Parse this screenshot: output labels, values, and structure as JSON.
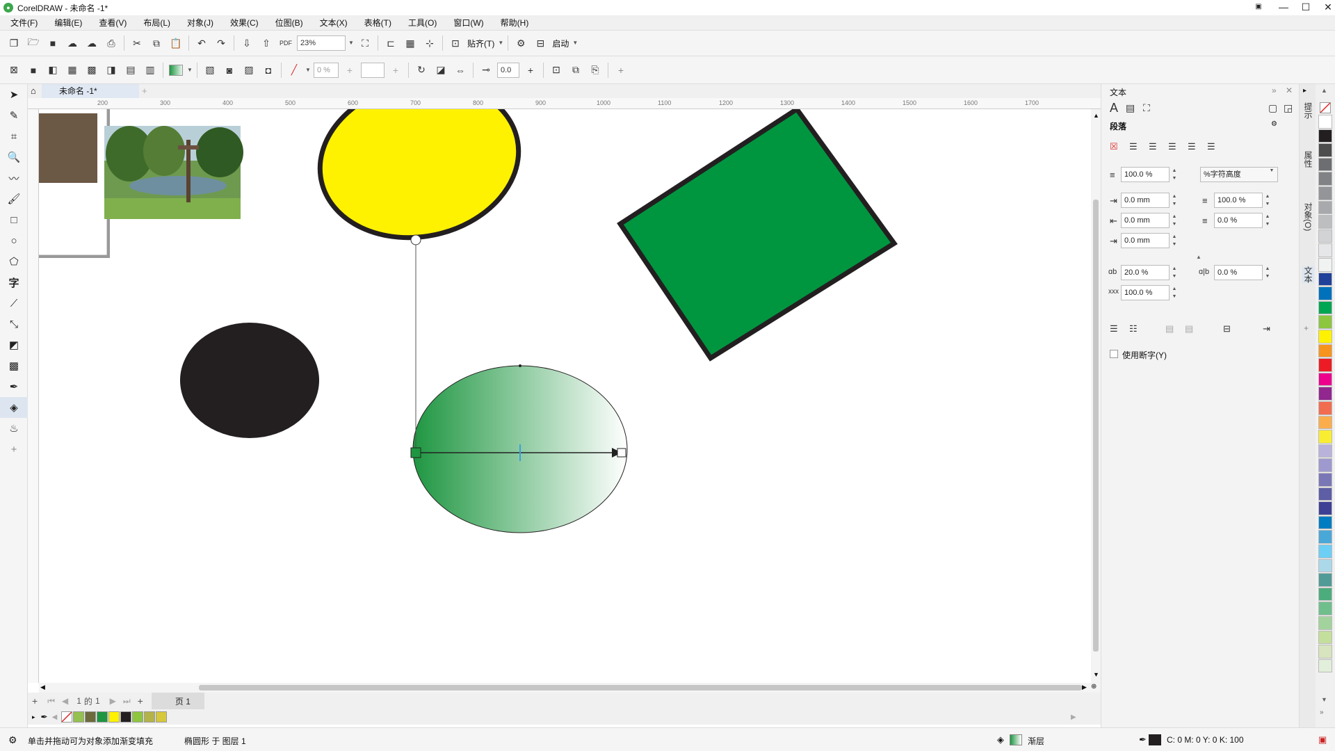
{
  "window": {
    "title": "CorelDRAW - 未命名 -1*",
    "minimize": "—",
    "maximize": "☐",
    "close": "✕"
  },
  "menu": [
    "文件(F)",
    "编辑(E)",
    "查看(V)",
    "布局(L)",
    "对象(J)",
    "效果(C)",
    "位图(B)",
    "文本(X)",
    "表格(T)",
    "工具(O)",
    "窗口(W)",
    "帮助(H)"
  ],
  "toolbar": {
    "zoom": "23%",
    "snap_label": "贴齐(T)",
    "launch_label": "启动"
  },
  "propbar": {
    "opacity": "0 %",
    "outline_width": "0.0"
  },
  "doc": {
    "tab_label": "未命名 -1*"
  },
  "ruler": {
    "h_ticks": [
      "200",
      "300",
      "400",
      "500",
      "600",
      "700",
      "800",
      "900",
      "1000",
      "1100",
      "1200",
      "1300",
      "1400",
      "1500",
      "1600",
      "1700"
    ]
  },
  "page": {
    "current": "1",
    "of_label": "的",
    "total": "1",
    "page_tab": "页 1"
  },
  "palette": [
    "#ffffff",
    "#94c14f",
    "#6d6a3c",
    "#1e9641",
    "#fff200",
    "#231f20",
    "#8ec63f",
    "#b3b34a",
    "#d6c83a"
  ],
  "status": {
    "hint": "单击并拖动可为对象添加渐变填充",
    "object_info": "椭圆形 于 图层 1",
    "fill_label": "渐层",
    "outline_info": "C: 0 M: 0 Y: 0 K: 100"
  },
  "panel": {
    "title": "文本",
    "section": "段落",
    "first_line_spacing": "100.0 %",
    "spacing_unit": "%字符高度",
    "left_indent": "0.0 mm",
    "first_indent": "0.0 mm",
    "right_indent": "0.0 mm",
    "before_para": "100.0 %",
    "after_para": "0.0 %",
    "char_spacing": "20.0 %",
    "word_spacing": "0.0 %",
    "lang_spacing": "100.0 %",
    "hyphen_label": "使用断字(Y)"
  },
  "sidetabs": [
    "提示",
    "属性",
    "对象(O)",
    "文本"
  ],
  "colorstrip": [
    "#ffffff",
    "#231f20",
    "#4d4d4d",
    "#6d6e71",
    "#808285",
    "#939598",
    "#a7a9ac",
    "#bcbec0",
    "#d1d3d4",
    "#e6e7e8",
    "#f1f2f2",
    "#21409a",
    "#0072bc",
    "#00a651",
    "#8dc63f",
    "#fff200",
    "#f7941d",
    "#ed1c24",
    "#ec008c",
    "#92278f",
    "#f26c4f",
    "#fbad4c",
    "#f9ed32",
    "#b9b3dc",
    "#9e9ad0",
    "#7a77b7",
    "#5d5ea6",
    "#3e4095",
    "#007cc3",
    "#4aa8d8",
    "#6dcff6",
    "#abd9e9",
    "#519b97",
    "#4cad7c",
    "#6fbf8d",
    "#a3d39c",
    "#c4df9b",
    "#d7e4bd",
    "#e2efda"
  ]
}
